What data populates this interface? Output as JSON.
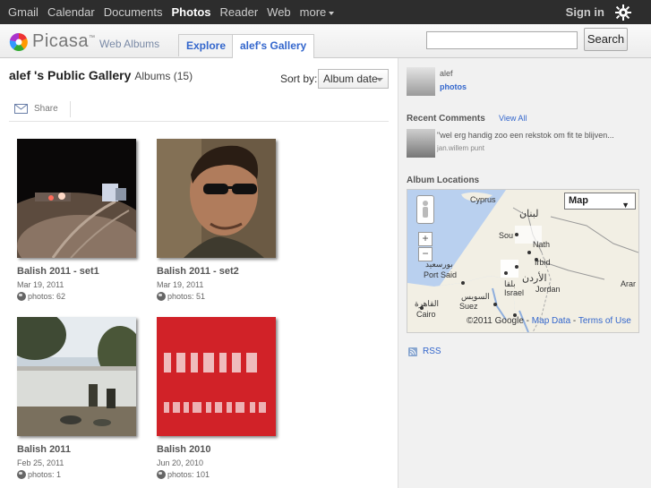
{
  "topbar": {
    "nav": [
      "Gmail",
      "Calendar",
      "Documents",
      "Photos",
      "Reader",
      "Web",
      "more"
    ],
    "active": "Photos",
    "sign_in": "Sign in"
  },
  "header": {
    "logo_text": "Picasa",
    "tm": "™",
    "web_albums": "Web Albums",
    "tabs": [
      "Explore",
      "alef's Gallery"
    ],
    "search_button": "Search",
    "search_value": ""
  },
  "gallery": {
    "title": "alef 's Public Gallery",
    "subtitle": "Albums (15)",
    "sort_label": "Sort by:",
    "sort_value": "Album date",
    "share": "Share"
  },
  "albums": [
    {
      "title": "Balish 2011 - set1",
      "date": "Mar 19, 2011",
      "photos": "photos: 62"
    },
    {
      "title": "Balish 2011 - set2",
      "date": "Mar 19, 2011",
      "photos": "photos: 51"
    },
    {
      "title": "Balish 2011",
      "date": "Feb 25, 2011",
      "photos": "photos: 1"
    },
    {
      "title": "Balish 2010",
      "date": "Jun 20, 2010",
      "photos": "photos: 101"
    }
  ],
  "sidebar": {
    "owner_name": "alef",
    "owner_photos": "photos",
    "recent_comments": "Recent Comments",
    "view_all": "View All",
    "comment_text": "\"wel erg handig zoo een rekstok om fit te blijven...",
    "comment_user": "jan.willem punt",
    "album_locations": "Album Locations",
    "rss": "RSS"
  },
  "map": {
    "type": "Map",
    "labels": [
      "Cyprus",
      "Irbid",
      "Port Said",
      "Jordan",
      "Israel",
      "Suez",
      "Cairo",
      "Arar",
      "Sou",
      "Nath"
    ],
    "arabic_labels": [
      "لبنان",
      "الأردن",
      "بورسعيد",
      "السويس",
      "القاهرة",
      "بلقا"
    ],
    "copyright": "©2011 Google",
    "sep": " - ",
    "map_data": "Map Data",
    "terms": "Terms of Use"
  },
  "colors": {
    "link": "#3366cc",
    "topbar": "#2d2d2d",
    "sidebar_bg": "#f1f1f1"
  }
}
